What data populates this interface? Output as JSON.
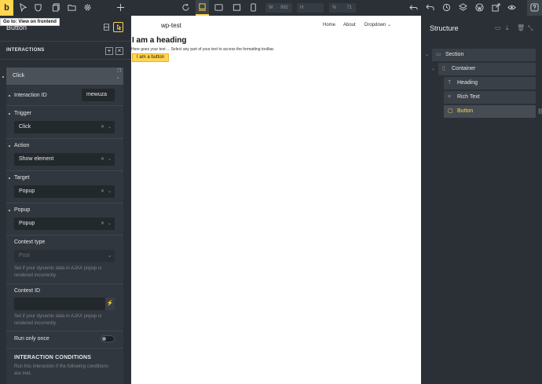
{
  "app": {
    "logo": "b",
    "tooltip": "Go to: View on frontend"
  },
  "toolbar": {
    "width_label": "W",
    "width_value": "992",
    "height_label": "H",
    "height_value": "",
    "zoom_label": "%",
    "zoom_value": "71"
  },
  "left_panel": {
    "title": "Button",
    "interactions_label": "INTERACTIONS",
    "interaction": {
      "name": "Click",
      "interaction_id_label": "Interaction ID",
      "interaction_id_value": "mewuza",
      "trigger_label": "Trigger",
      "trigger_value": "Click",
      "action_label": "Action",
      "action_value": "Show element",
      "target_label": "Target",
      "target_value": "Popup",
      "popup_label": "Popup",
      "popup_value": "Popup",
      "context_type_label": "Context type",
      "context_type_placeholder": "Post",
      "context_type_help": "Set if your dynamic data in AJAX popup is rendered incorrectly.",
      "context_id_label": "Context ID",
      "context_id_value": "",
      "context_id_help": "Set if your dynamic data in AJAX popup is rendered incorrectly.",
      "run_once_label": "Run only once",
      "run_once_enabled": false,
      "conditions_title": "INTERACTION CONDITIONS",
      "conditions_help": "Run this interaction if the following conditions are met."
    }
  },
  "canvas": {
    "site_title": "wp-test",
    "nav": [
      "Home",
      "About",
      "Dropdown"
    ],
    "heading": "I am a heading",
    "rich_text": "Here goes your text ... Select any part of your text to access the formatting toolbar.",
    "button": "I am a button"
  },
  "structure": {
    "title": "Structure",
    "items": [
      {
        "label": "Section",
        "icon": "section-icon"
      },
      {
        "label": "Container",
        "icon": "container-icon"
      },
      {
        "label": "Heading",
        "icon": "heading-icon"
      },
      {
        "label": "Rich Text",
        "icon": "text-icon"
      },
      {
        "label": "Button",
        "icon": "button-icon"
      }
    ]
  },
  "colors": {
    "accent": "#ffd64f",
    "panel": "#2b3036",
    "panel_dark": "#23282d"
  }
}
